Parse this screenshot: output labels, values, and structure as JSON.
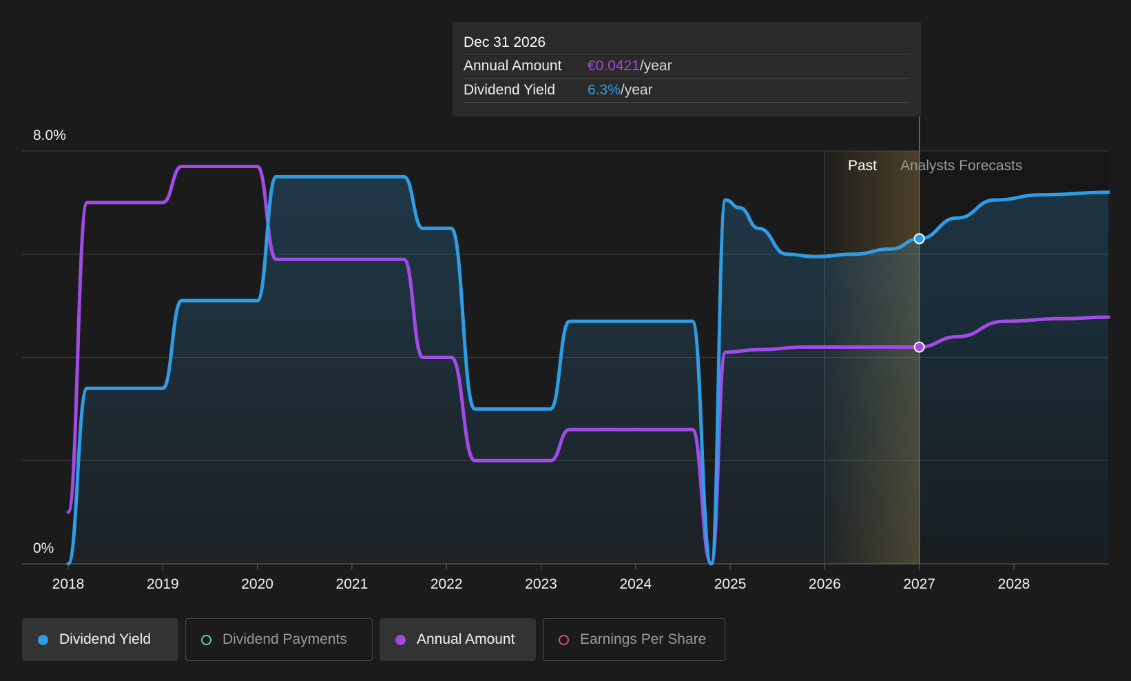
{
  "tooltip": {
    "date": "Dec 31 2026",
    "rows": [
      {
        "label": "Annual Amount",
        "value": "€0.0421",
        "unit": "/year"
      },
      {
        "label": "Dividend Yield",
        "value": "6.3%",
        "unit": "/year"
      }
    ]
  },
  "period_labels": {
    "past": "Past",
    "forecast": "Analysts Forecasts"
  },
  "legend": [
    {
      "label": "Dividend Yield",
      "active": true,
      "color": "#2e9de6"
    },
    {
      "label": "Dividend Payments",
      "active": false,
      "color": "#5fd6b8"
    },
    {
      "label": "Annual Amount",
      "active": true,
      "color": "#a24be6"
    },
    {
      "label": "Earnings Per Share",
      "active": false,
      "color": "#e24b8a"
    }
  ],
  "colors": {
    "yield": "#2e9de6",
    "amount": "#a24be6",
    "forecast_band": "#c9a24a",
    "grid": "#3a3a3a"
  },
  "chart_data": {
    "type": "line",
    "x_ticks": [
      "2018",
      "2019",
      "2020",
      "2021",
      "2022",
      "2023",
      "2024",
      "2025",
      "2026",
      "2027",
      "2028"
    ],
    "y_tick_labels": [
      "8.0%",
      "0%"
    ],
    "ylim": [
      0,
      8.0
    ],
    "xlim": [
      2018,
      2029
    ],
    "forecast_start": 2027,
    "highlight_x": 2027,
    "series": [
      {
        "name": "Dividend Yield",
        "unit": "%",
        "points": [
          [
            2018.0,
            0.0
          ],
          [
            2018.2,
            3.4
          ],
          [
            2019.0,
            3.4
          ],
          [
            2019.2,
            5.1
          ],
          [
            2020.0,
            5.1
          ],
          [
            2020.2,
            7.5
          ],
          [
            2021.55,
            7.5
          ],
          [
            2021.75,
            6.5
          ],
          [
            2022.05,
            6.5
          ],
          [
            2022.3,
            3.0
          ],
          [
            2023.1,
            3.0
          ],
          [
            2023.3,
            4.7
          ],
          [
            2024.6,
            4.7
          ],
          [
            2024.8,
            0.0
          ],
          [
            2024.95,
            7.05
          ],
          [
            2025.1,
            6.9
          ],
          [
            2025.3,
            6.5
          ],
          [
            2025.6,
            6.0
          ],
          [
            2025.9,
            5.95
          ],
          [
            2026.3,
            6.0
          ],
          [
            2026.7,
            6.1
          ],
          [
            2027.0,
            6.3
          ],
          [
            2027.4,
            6.7
          ],
          [
            2027.8,
            7.05
          ],
          [
            2028.3,
            7.15
          ],
          [
            2029.0,
            7.2
          ]
        ]
      },
      {
        "name": "Annual Amount",
        "unit": "%",
        "points": [
          [
            2018.0,
            1.0
          ],
          [
            2018.2,
            7.0
          ],
          [
            2019.0,
            7.0
          ],
          [
            2019.2,
            7.7
          ],
          [
            2020.0,
            7.7
          ],
          [
            2020.2,
            5.9
          ],
          [
            2021.55,
            5.9
          ],
          [
            2021.75,
            4.0
          ],
          [
            2022.05,
            4.0
          ],
          [
            2022.3,
            2.0
          ],
          [
            2023.1,
            2.0
          ],
          [
            2023.3,
            2.6
          ],
          [
            2024.6,
            2.6
          ],
          [
            2024.8,
            0.0
          ],
          [
            2024.95,
            4.1
          ],
          [
            2025.3,
            4.15
          ],
          [
            2025.8,
            4.2
          ],
          [
            2026.3,
            4.2
          ],
          [
            2027.0,
            4.2
          ],
          [
            2027.4,
            4.4
          ],
          [
            2027.9,
            4.7
          ],
          [
            2028.5,
            4.75
          ],
          [
            2029.0,
            4.78
          ]
        ]
      }
    ],
    "highlight_values": {
      "Dividend Yield": "6.3%",
      "Annual Amount": "€0.0421"
    }
  }
}
